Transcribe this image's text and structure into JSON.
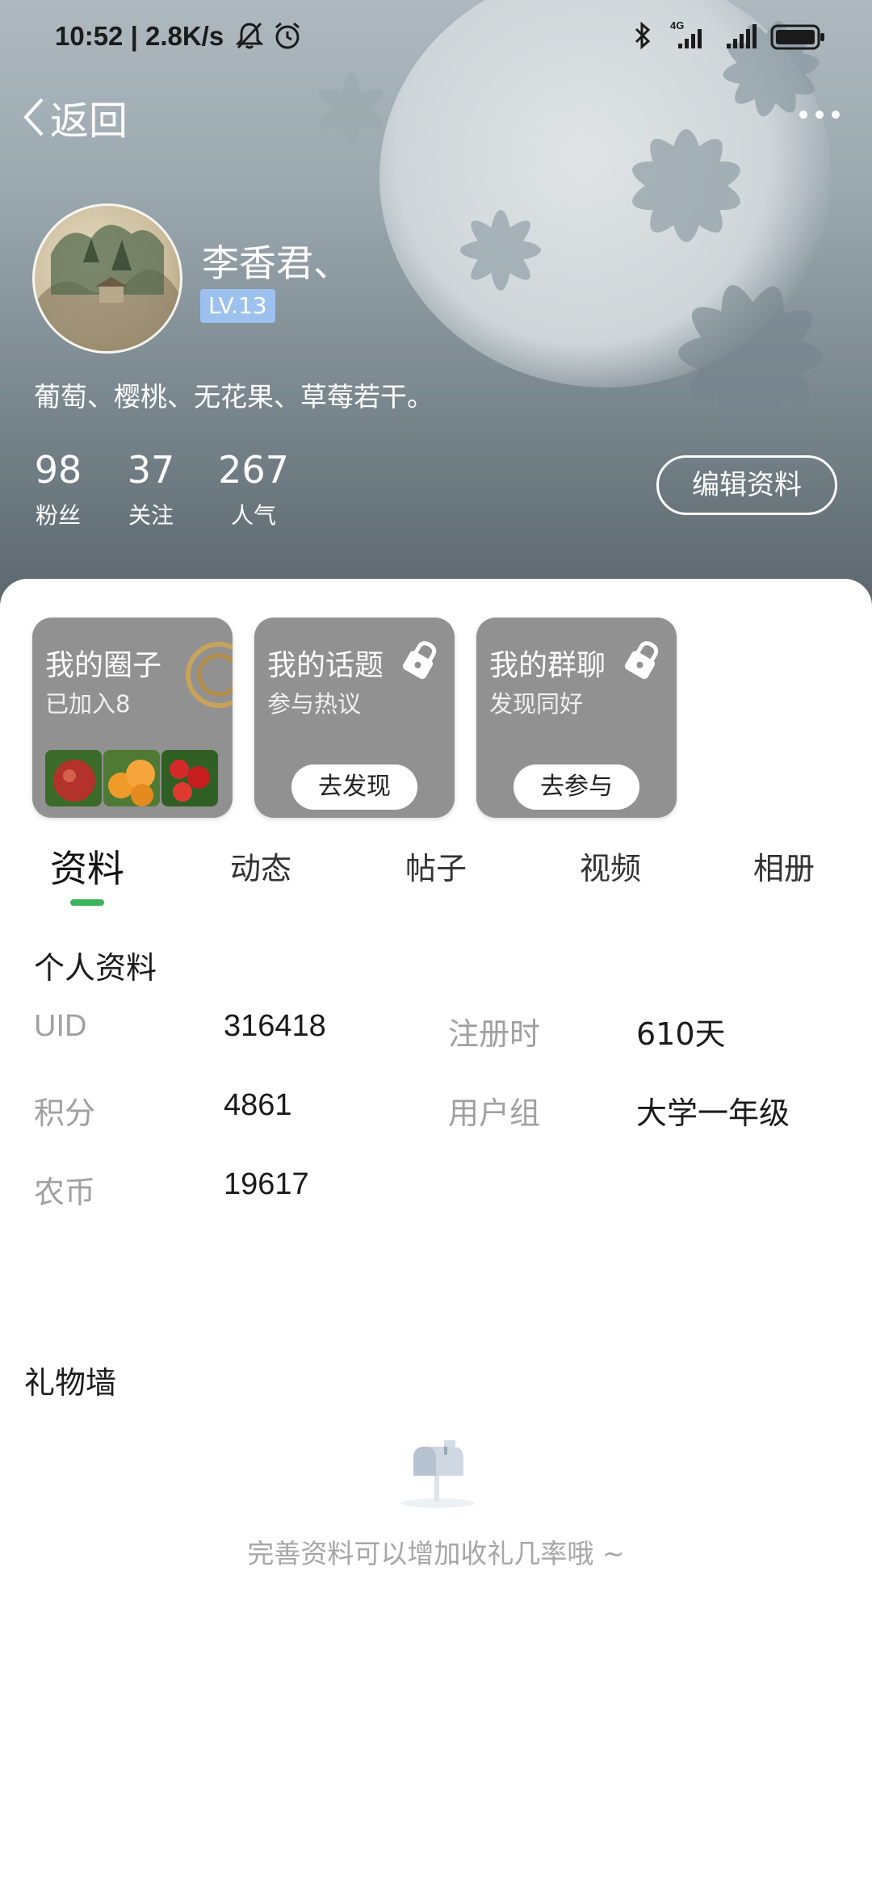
{
  "status_bar": {
    "time": "10:52 | 2.8K/s",
    "icons": [
      "bell-muted-icon",
      "alarm-icon",
      "bluetooth-icon",
      "signal-4g-icon",
      "signal-icon",
      "battery-icon"
    ],
    "network_label": "4G"
  },
  "nav": {
    "back_label": "返回",
    "more_icon": "more-icon"
  },
  "profile": {
    "name": "李香君、",
    "level": "LV.13",
    "bio": "葡萄、樱桃、无花果、草莓若干。",
    "stats": [
      {
        "value": "98",
        "label": "粉丝"
      },
      {
        "value": "37",
        "label": "关注"
      },
      {
        "value": "267",
        "label": "人气"
      }
    ],
    "edit_button": "编辑资料"
  },
  "cards": [
    {
      "title": "我的圈子",
      "subtitle": "已加入8",
      "button": ""
    },
    {
      "title": "我的话题",
      "subtitle": "参与热议",
      "button": "去发现"
    },
    {
      "title": "我的群聊",
      "subtitle": "发现同好",
      "button": "去参与"
    }
  ],
  "tabs": [
    "资料",
    "动态",
    "帖子",
    "视频",
    "相册"
  ],
  "active_tab": "资料",
  "personal_info": {
    "title": "个人资料",
    "rows": [
      {
        "label": "UID",
        "value": "316418"
      },
      {
        "label": "注册时",
        "value": "610天"
      },
      {
        "label": "积分",
        "value": "4861"
      },
      {
        "label": "用户组",
        "value": "大学一年级"
      },
      {
        "label": "农币",
        "value": "19617"
      }
    ]
  },
  "gift_wall": {
    "title": "礼物墙",
    "empty_text": "完善资料可以增加收礼几率哦 ~"
  },
  "colors": {
    "accent_green": "#3cb55a",
    "level_badge": "#9cc1ef",
    "card_bg": "#919191"
  }
}
